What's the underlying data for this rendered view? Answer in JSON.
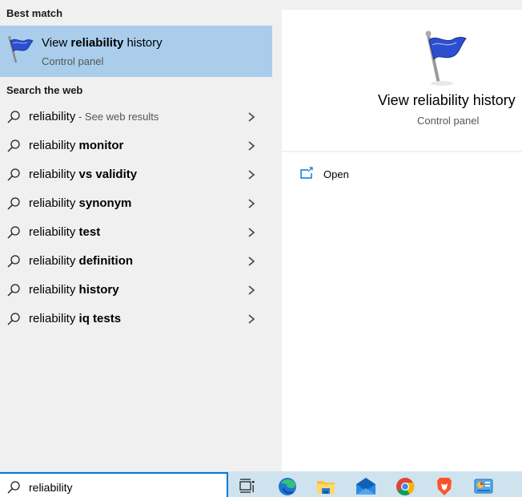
{
  "left_panel": {
    "best_match_label": "Best match",
    "best_match": {
      "title_pre": "View ",
      "title_bold": "reliability",
      "title_post": " history",
      "subtitle": "Control panel",
      "icon": "blue-flag-icon"
    },
    "search_web_label": "Search the web",
    "web_results": [
      {
        "prefix": "reliability",
        "bold": "",
        "suffix": " - See web results"
      },
      {
        "prefix": "reliability ",
        "bold": "monitor",
        "suffix": ""
      },
      {
        "prefix": "reliability ",
        "bold": "vs validity",
        "suffix": ""
      },
      {
        "prefix": "reliability ",
        "bold": "synonym",
        "suffix": ""
      },
      {
        "prefix": "reliability ",
        "bold": "test",
        "suffix": ""
      },
      {
        "prefix": "reliability ",
        "bold": "definition",
        "suffix": ""
      },
      {
        "prefix": "reliability ",
        "bold": "history",
        "suffix": ""
      },
      {
        "prefix": "reliability ",
        "bold": "iq tests",
        "suffix": ""
      }
    ]
  },
  "right_panel": {
    "title": "View reliability history",
    "subtitle": "Control panel",
    "actions": [
      {
        "label": "Open",
        "icon": "open-external-icon"
      }
    ]
  },
  "taskbar": {
    "search_value": "reliability",
    "apps": [
      {
        "name": "task-view",
        "icon": "task-view-icon"
      },
      {
        "name": "edge",
        "icon": "edge-icon"
      },
      {
        "name": "file-explorer",
        "icon": "folder-icon"
      },
      {
        "name": "mail",
        "icon": "mail-icon"
      },
      {
        "name": "chrome",
        "icon": "chrome-icon"
      },
      {
        "name": "brave",
        "icon": "brave-icon"
      },
      {
        "name": "control-panel",
        "icon": "control-panel-icon"
      }
    ]
  },
  "colors": {
    "highlight": "#a9cdeb",
    "accent": "#0078d7",
    "taskbar": "#cfe3ef"
  }
}
